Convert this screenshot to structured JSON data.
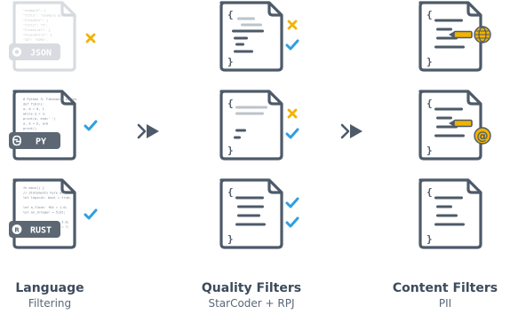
{
  "stages": [
    {
      "id": "language",
      "title": "Language",
      "subtitle": "Filtering",
      "files": [
        {
          "badge": "JSON",
          "badge_icon": "json-icon",
          "status": "rejected",
          "faded": true,
          "code": [
            "\"example\": {",
            "  \"title\": \"example glossary\",",
            "  \"GlossDiv\": {",
            "    \"title\": \"S\",",
            "    \"GlossList\": {",
            "      \"GlossEntry\": {",
            "        \"ID\": \"SGML\",",
            "        \"SortAs\": \"SGML\""
          ]
        },
        {
          "badge": "PY",
          "badge_icon": "python-icon",
          "status": "accepted",
          "faded": false,
          "code": [
            "# Python 3: Fibonacci series",
            "def fib(n):",
            "    a, b = 0, 1",
            "    while a < n:",
            "        print(a, end=' ')",
            "        a, b = b, a+b",
            "    print()",
            "fib(1000)"
          ]
        },
        {
          "badge": "RUST",
          "badge_icon": "rust-icon",
          "status": "accepted",
          "faded": false,
          "code": [
            "fn main() {",
            "    // Statements here are",
            "    let logical: bool = true;",
            "",
            "    let a_float: f64 = 1.0;",
            "    let an_integer = 5i32;",
            "",
            "    let default_float = 3.0;",
            "    let default_integer = 7;"
          ]
        }
      ]
    },
    {
      "id": "quality",
      "title": "Quality Filters",
      "subtitle": "StarCoder + RPJ",
      "files": [
        {
          "status": "both",
          "doc_style": "messy"
        },
        {
          "status": "both",
          "doc_style": "sparse"
        },
        {
          "status": "double-accepted",
          "doc_style": "clean"
        }
      ]
    },
    {
      "id": "content",
      "title": "Content Filters",
      "subtitle": "PII",
      "files": [
        {
          "status": "marker",
          "doc_style": "clean",
          "marker_icon": "globe-icon"
        },
        {
          "status": "marker",
          "doc_style": "clean",
          "marker_icon": "at-sign-icon"
        },
        {
          "status": "none",
          "doc_style": "clean"
        }
      ]
    }
  ],
  "arrows": [
    "arrow-1",
    "arrow-2"
  ],
  "colors": {
    "outline": "#4d5a69",
    "badge": "#5c6773",
    "check": "#2f9fe0",
    "cross": "#f0b300",
    "marker": "#f0b300",
    "faded_line": "#bcc3cb",
    "muted": "#aab2bb"
  }
}
